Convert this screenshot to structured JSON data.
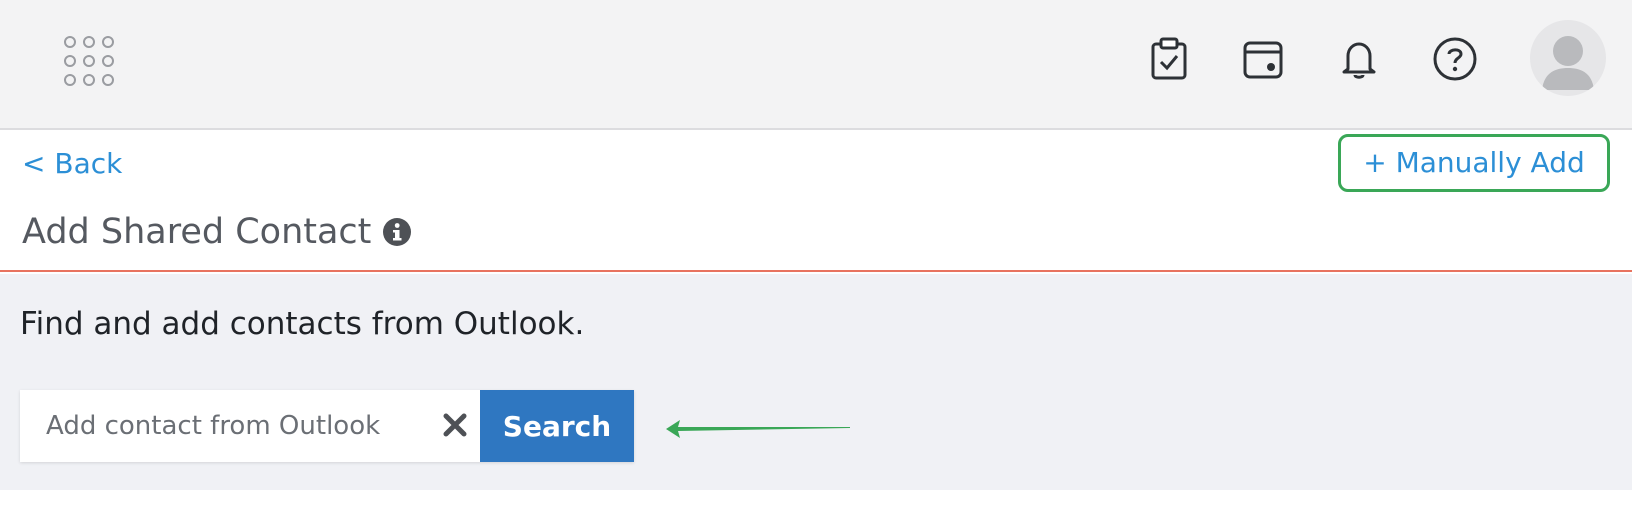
{
  "topbar": {
    "icons": [
      "apps-grid-icon",
      "clipboard-check-icon",
      "calendar-icon",
      "bell-icon",
      "help-icon",
      "user-avatar-icon"
    ]
  },
  "header": {
    "back_label": "< Back",
    "manual_add_label": "+ Manually Add",
    "title": "Add Shared Contact",
    "title_icon": "info-icon"
  },
  "body": {
    "description": "Find and add contacts from Outlook.",
    "search": {
      "placeholder": "Add contact from Outlook",
      "value": "",
      "clear_icon": "close-icon",
      "button_label": "Search"
    }
  },
  "colors": {
    "link": "#2c8fd6",
    "primary_button": "#2f77c1",
    "highlight": "#3aa757",
    "divider": "#e8735f"
  }
}
